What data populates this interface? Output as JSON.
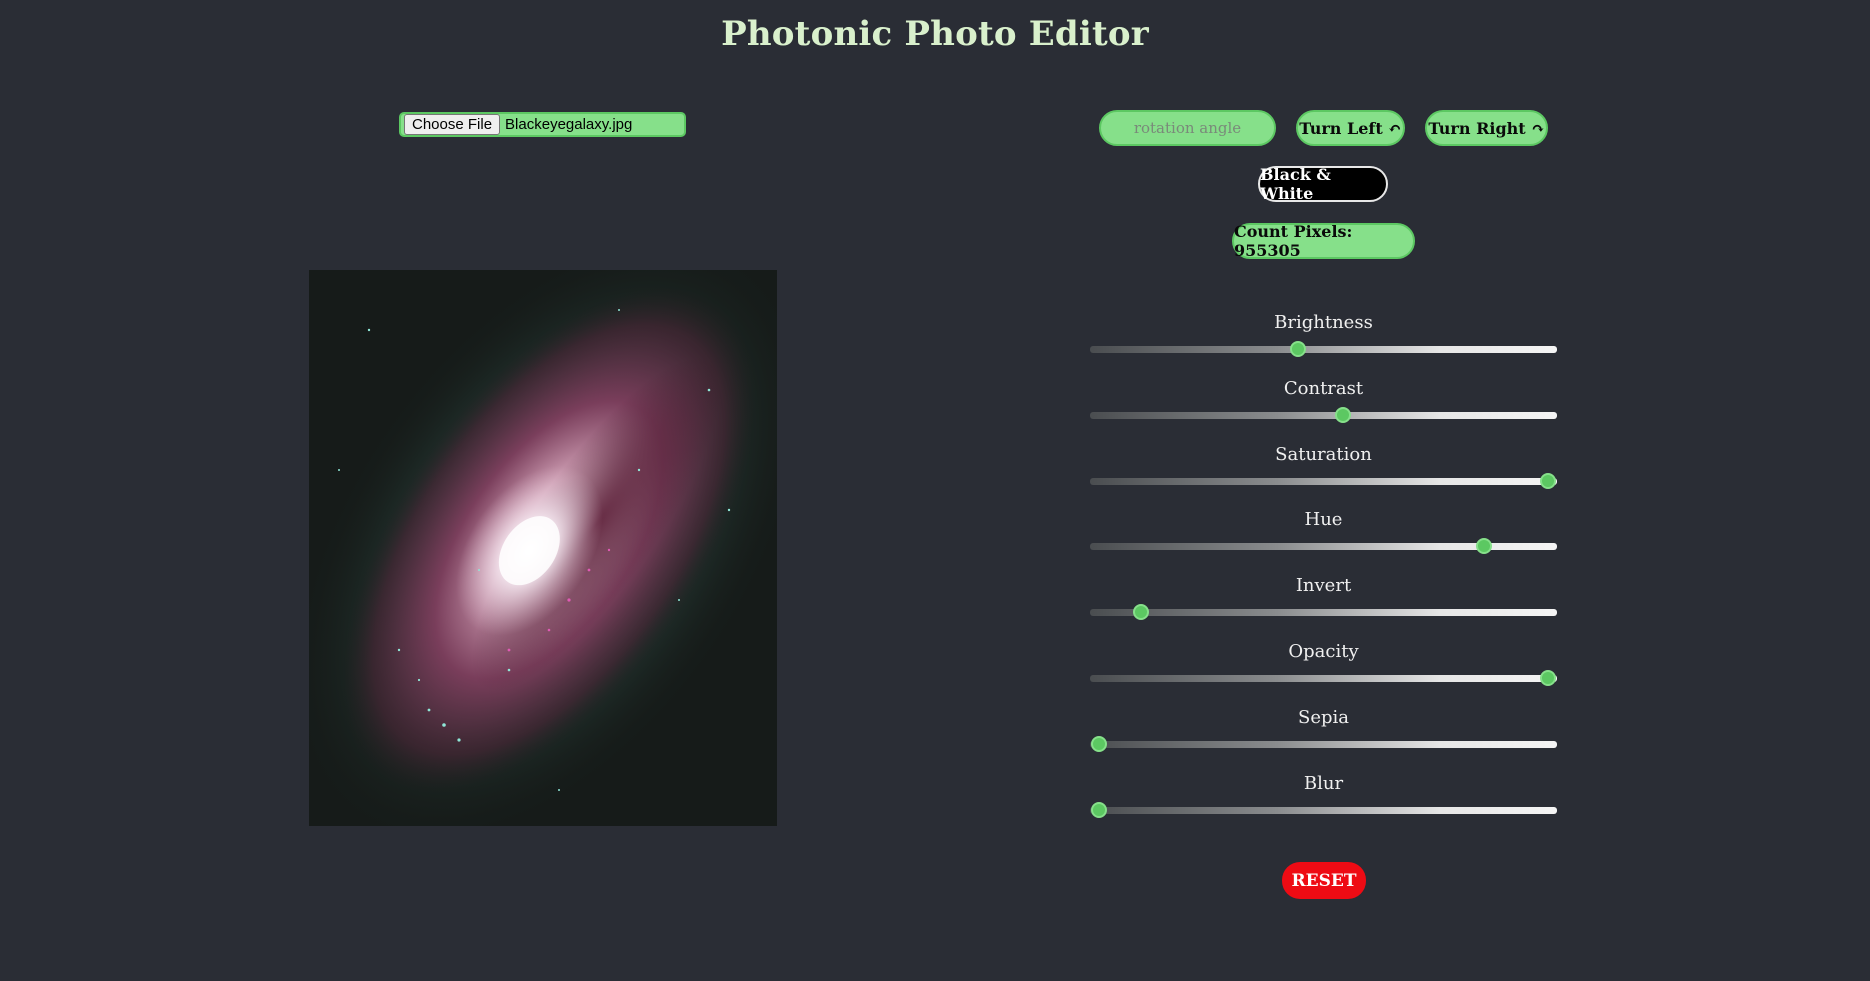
{
  "app": {
    "title": "Photonic Photo Editor"
  },
  "file": {
    "button_label": "Choose File",
    "file_name": "Blackeyegalaxy.jpg"
  },
  "rotation": {
    "placeholder": "rotation angle",
    "turn_left_label": "Turn Left ↶",
    "turn_right_label": "Turn Right ↷"
  },
  "bw_label": "Black & White",
  "count_label": "Count Pixels: 955305",
  "sliders": [
    {
      "label": "Brightness",
      "value": 0.443
    },
    {
      "label": "Contrast",
      "value": 0.543
    },
    {
      "label": "Saturation",
      "value": 1.0
    },
    {
      "label": "Hue",
      "value": 0.857
    },
    {
      "label": "Invert",
      "value": 0.093
    },
    {
      "label": "Opacity",
      "value": 1.0
    },
    {
      "label": "Sepia",
      "value": 0.0
    },
    {
      "label": "Blur",
      "value": 0.0
    }
  ],
  "reset_label": "RESET",
  "colors": {
    "accent": "#86e08a",
    "accent_border": "#5cc862",
    "reset": "#ee0b14",
    "background": "#2a2d35"
  }
}
